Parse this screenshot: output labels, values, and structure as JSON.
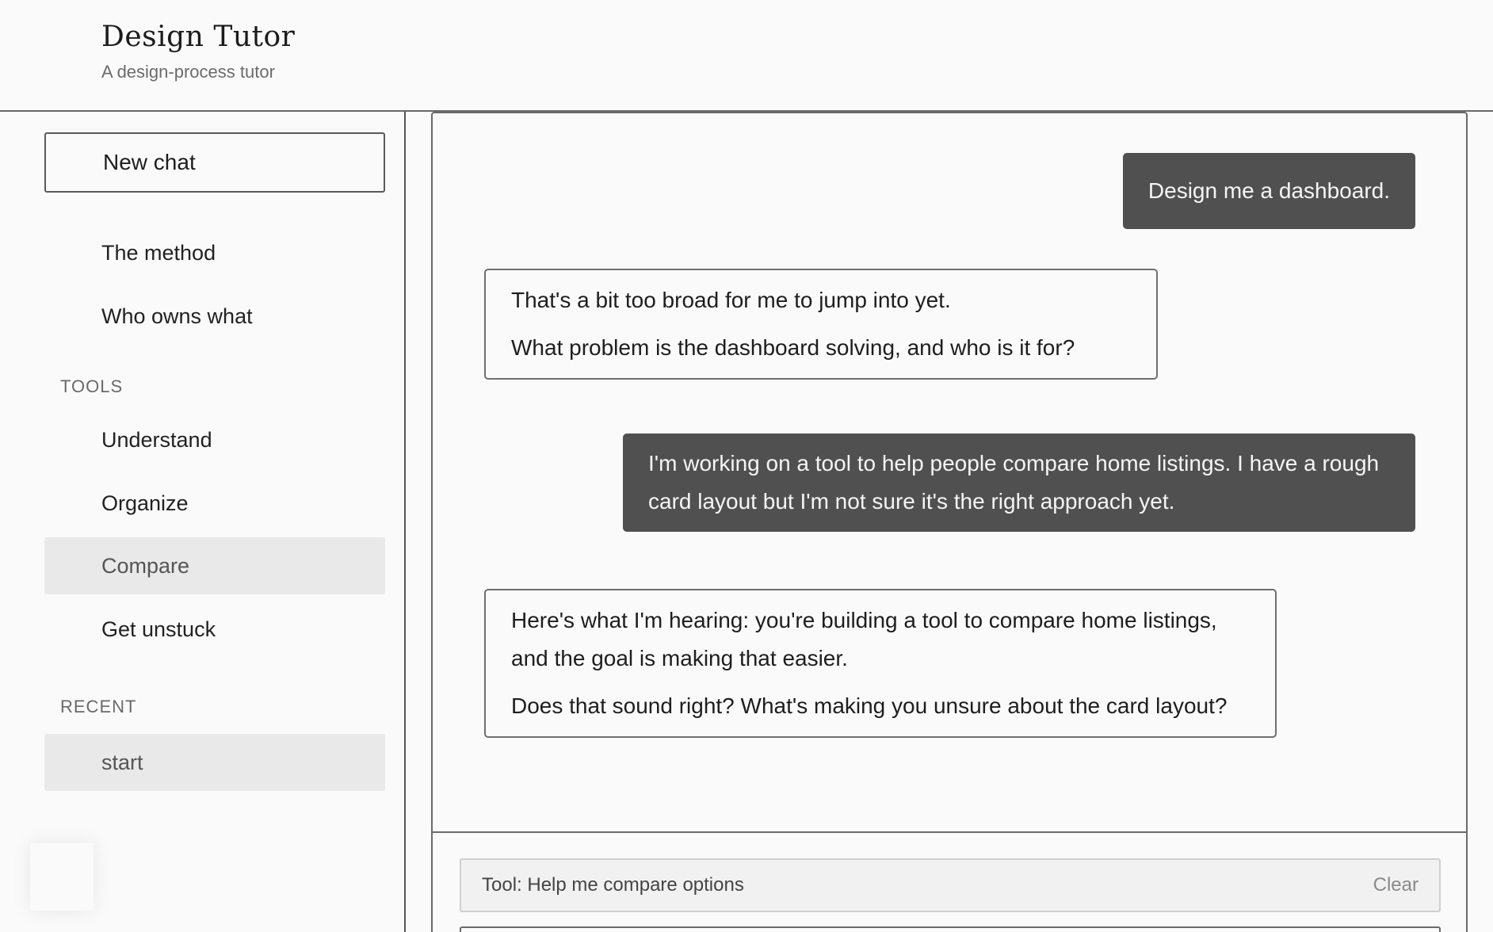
{
  "app": {
    "title": "Design Tutor",
    "subtitle": "A design-process tutor"
  },
  "sidebar": {
    "new_chat_label": "New chat",
    "top_items": [
      {
        "label": "The method"
      },
      {
        "label": "Who owns what"
      }
    ],
    "tools_label": "TOOLS",
    "tools": [
      {
        "label": "Understand",
        "active": false
      },
      {
        "label": "Organize",
        "active": false
      },
      {
        "label": "Compare",
        "active": true
      },
      {
        "label": "Get unstuck",
        "active": false
      }
    ],
    "recent_label": "RECENT",
    "recent": [
      {
        "label": "start",
        "active": true
      }
    ]
  },
  "chat": {
    "messages": [
      {
        "role": "user",
        "paragraphs": [
          "Design me a dashboard."
        ]
      },
      {
        "role": "assistant",
        "paragraphs": [
          "That's a bit too broad for me to jump into yet.",
          "What problem is the dashboard solving, and who is it for?"
        ]
      },
      {
        "role": "user",
        "paragraphs": [
          "I'm working on a tool to help people compare home listings. I have a rough card layout but I'm not sure it's the right approach yet."
        ]
      },
      {
        "role": "assistant",
        "paragraphs": [
          "Here's what I'm hearing: you're building a tool to compare home listings, and the goal is making that easier.",
          "Does that sound right? What's making you unsure about the card layout?"
        ]
      }
    ]
  },
  "composer": {
    "tool_text": "Tool: Help me compare options",
    "clear_label": "Clear"
  },
  "colors": {
    "user_bubble": "#505050",
    "active_item": "#e9e9e9",
    "background": "#fafafa"
  }
}
